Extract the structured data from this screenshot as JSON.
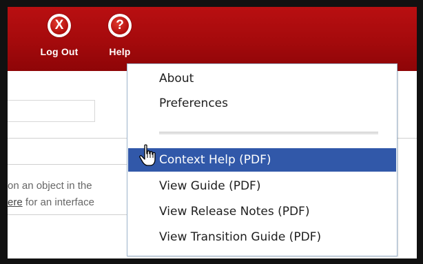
{
  "header": {
    "logout_label": "Log Out",
    "logout_icon_glyph": "X",
    "help_label": "Help",
    "help_icon_glyph": "?",
    "brand_color": "#a40a0c"
  },
  "content": {
    "line1": "on an object in the",
    "line2_prefix": "ere",
    "line2_rest": " for an interface"
  },
  "help_menu": {
    "items": [
      {
        "label": "About"
      },
      {
        "label": "Preferences"
      },
      {
        "label": "Context Help (PDF)"
      },
      {
        "label": "View Guide (PDF)"
      },
      {
        "label": "View Release Notes (PDF)"
      },
      {
        "label": "View Transition Guide (PDF)"
      }
    ],
    "highlighted_item": "Context Help (PDF)",
    "highlight_color": "#3158a9"
  },
  "cursor": {
    "icon": "hand-pointer-icon"
  }
}
